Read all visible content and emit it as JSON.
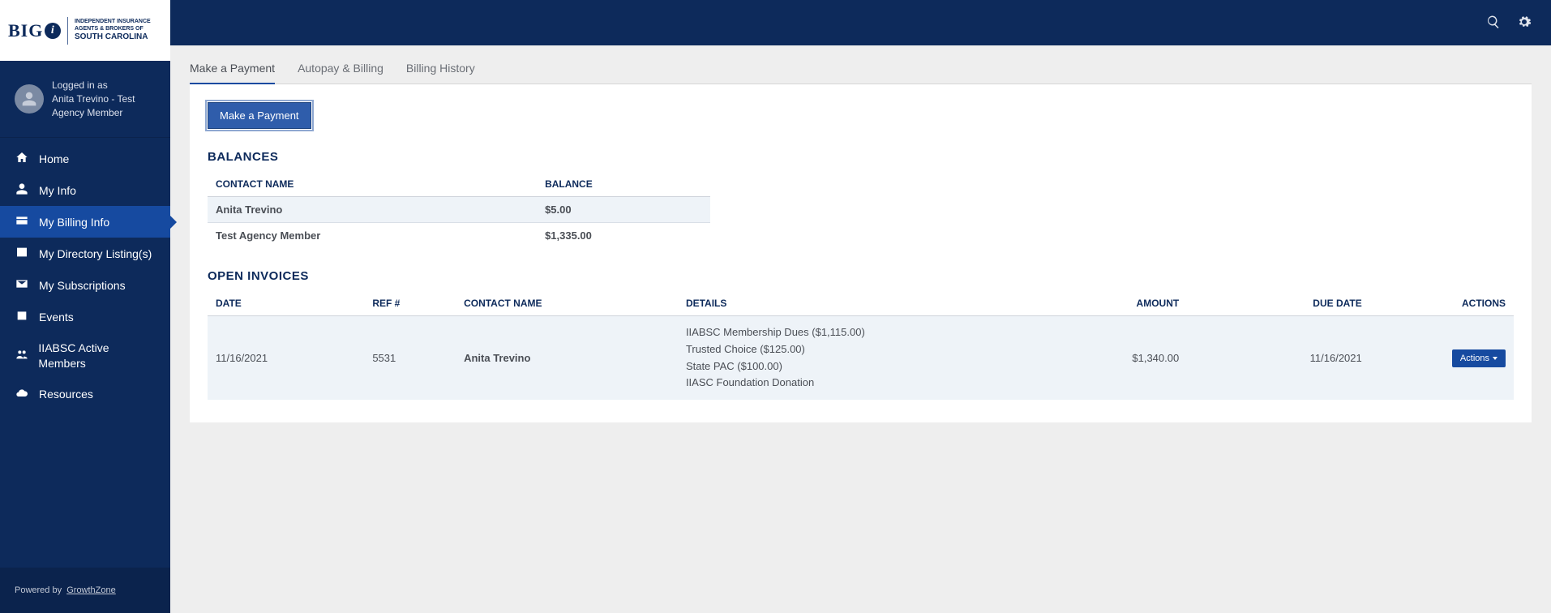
{
  "logo": {
    "big": "BIG",
    "i": "i",
    "sub1": "INDEPENDENT INSURANCE AGENTS & BROKERS OF",
    "sub2": "SOUTH CAROLINA"
  },
  "user": {
    "logged_in_label": "Logged in as",
    "name_line1": "Anita Trevino - Test",
    "name_line2": "Agency Member"
  },
  "nav": {
    "home": "Home",
    "my_info": "My Info",
    "my_billing_info": "My Billing Info",
    "my_directory": "My Directory Listing(s)",
    "my_subscriptions": "My Subscriptions",
    "events": "Events",
    "iiabsc_active_members": "IIABSC Active Members",
    "resources": "Resources"
  },
  "footer": {
    "powered_by": "Powered by",
    "vendor": "GrowthZone"
  },
  "tabs": {
    "make_payment": "Make a Payment",
    "autopay_billing": "Autopay & Billing",
    "billing_history": "Billing History"
  },
  "buttons": {
    "make_payment": "Make a Payment",
    "actions": "Actions"
  },
  "sections": {
    "balances_title": "BALANCES",
    "open_invoices_title": "OPEN INVOICES"
  },
  "balances": {
    "headers": {
      "contact_name": "CONTACT NAME",
      "balance": "BALANCE"
    },
    "rows": [
      {
        "name": "Anita Trevino",
        "balance": "$5.00"
      },
      {
        "name": "Test Agency Member",
        "balance": "$1,335.00"
      }
    ]
  },
  "invoices": {
    "headers": {
      "date": "DATE",
      "ref": "REF #",
      "contact_name": "CONTACT NAME",
      "details": "DETAILS",
      "amount": "AMOUNT",
      "due_date": "DUE DATE",
      "actions": "ACTIONS"
    },
    "rows": [
      {
        "date": "11/16/2021",
        "ref": "5531",
        "contact_name": "Anita Trevino",
        "details": [
          "IIABSC Membership Dues ($1,115.00)",
          "Trusted Choice ($125.00)",
          "State PAC ($100.00)",
          "IIASC Foundation Donation"
        ],
        "amount": "$1,340.00",
        "due_date": "11/16/2021"
      }
    ]
  }
}
